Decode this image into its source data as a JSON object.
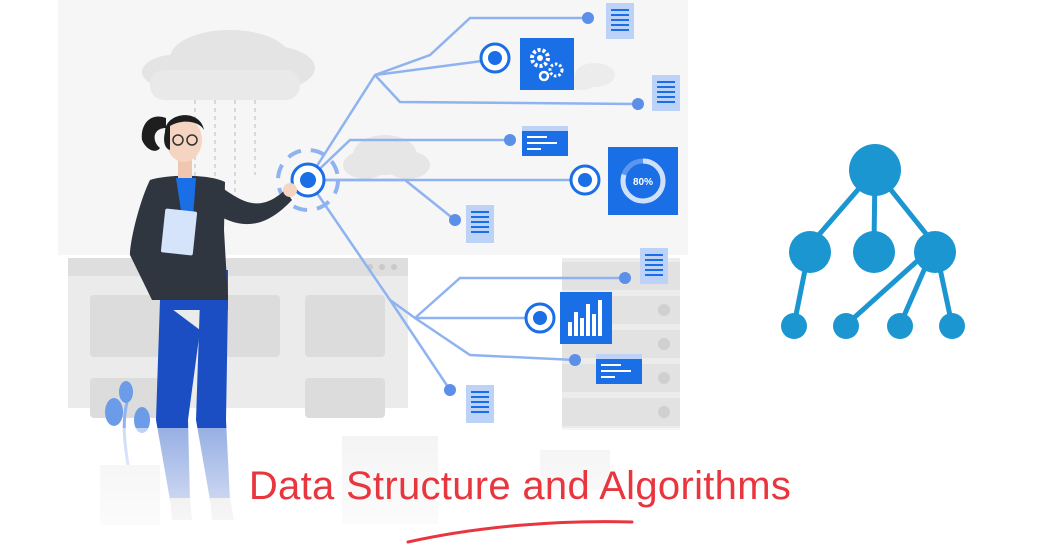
{
  "title": "Data Structure and Algorithms",
  "gauge_label": "80%",
  "gauge_percent": 80,
  "colors": {
    "title": "#e8353e",
    "accent_blue": "#1a6ee6",
    "line_blue": "#8fb3f0",
    "tree_blue": "#1b96d0",
    "panel_gray": "#ececec"
  },
  "icons": [
    "document-icon",
    "gears-icon",
    "gauge-icon",
    "bar-chart-icon",
    "code-window-icon",
    "cloud-icon",
    "plant-icon",
    "tree-structure-icon",
    "person-illustration"
  ]
}
